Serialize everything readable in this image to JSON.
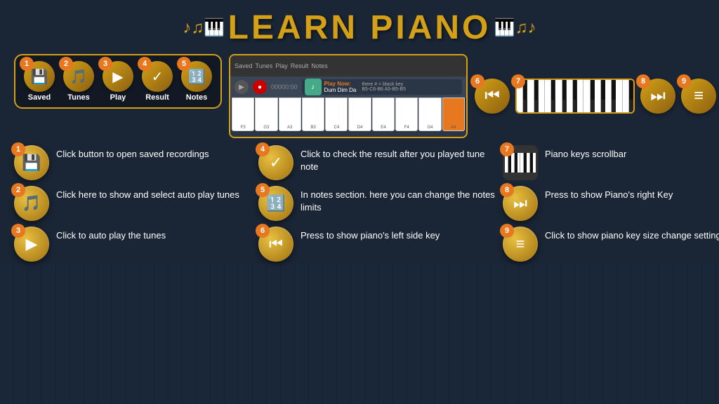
{
  "title": "LEARN PIANO",
  "toolbar": {
    "buttons": [
      {
        "num": "1",
        "label": "Saved",
        "icon": "💾"
      },
      {
        "num": "2",
        "label": "Tunes",
        "icon": "🎵"
      },
      {
        "num": "3",
        "label": "Play",
        "icon": "▶"
      },
      {
        "num": "4",
        "label": "Result",
        "icon": "✓"
      },
      {
        "num": "5",
        "label": "Notes",
        "icon": "🔢"
      }
    ]
  },
  "explanations": [
    {
      "num": "1",
      "icon": "💾",
      "text": "Click button to open saved recordings"
    },
    {
      "num": "2",
      "icon": "🎵",
      "text": "Click here to show and select  auto play tunes"
    },
    {
      "num": "3",
      "icon": "▶",
      "text": "Click to auto play\nthe tunes"
    },
    {
      "num": "4",
      "icon": "✓",
      "text": "Click to check the result after you played tune note"
    },
    {
      "num": "5",
      "icon": "🔢",
      "text": "In notes section. here you  can change the notes limits"
    },
    {
      "num": "6",
      "icon": "⏮",
      "text": "Press to show piano's left side key"
    },
    {
      "num": "7",
      "icon": "🎹",
      "text": "Piano keys scrollbar"
    },
    {
      "num": "8",
      "icon": "⏭",
      "text": "Press to show Piano's right Key"
    },
    {
      "num": "9",
      "icon": "≡",
      "text": "Click to show  piano key size change setting"
    }
  ],
  "badge_color": "#e87820"
}
